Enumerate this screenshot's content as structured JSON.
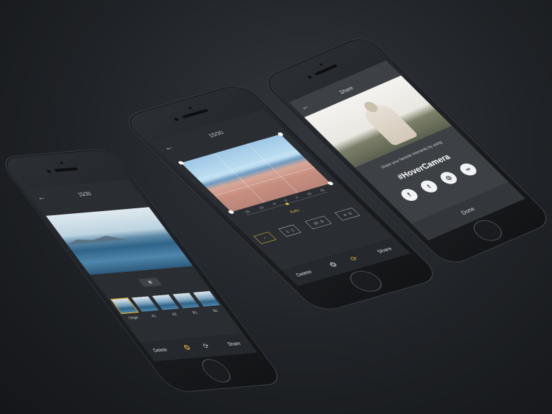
{
  "phones": {
    "edit": {
      "back_icon": "←",
      "counter": "15/30",
      "magic_icon": "✲",
      "filters": [
        {
          "name": "Origin",
          "selected": true
        },
        {
          "name": "A1",
          "selected": false
        },
        {
          "name": "A2",
          "selected": false
        },
        {
          "name": "B1",
          "selected": false
        },
        {
          "name": "B2",
          "selected": false
        }
      ],
      "bottom": {
        "delete": "Delete",
        "share": "Share"
      }
    },
    "crop": {
      "back_icon": "←",
      "counter": "15/30",
      "dial_ticks": [
        "-15",
        "-10",
        "-5",
        "0",
        "5",
        "10",
        "15"
      ],
      "auto_label": "Auto",
      "ratios": [
        {
          "label": "⌐",
          "selected": true
        },
        {
          "label": "1 : 1",
          "selected": false
        },
        {
          "label": "16 : 9",
          "selected": false
        },
        {
          "label": "4 : 3",
          "selected": false
        }
      ],
      "bottom": {
        "delete": "Delete",
        "share": "Share"
      }
    },
    "share": {
      "back_icon": "←",
      "title": "Share",
      "message": "Share your favorite moments by using",
      "hashtag": "#HoverCamera",
      "socials": [
        {
          "name": "facebook",
          "glyph": "f"
        },
        {
          "name": "twitter",
          "glyph": "t"
        },
        {
          "name": "instagram",
          "glyph": "◎"
        },
        {
          "name": "wechat",
          "glyph": "∞"
        }
      ],
      "done": "Done"
    }
  },
  "colors": {
    "accent": "#e3b93a",
    "background": "#1f2226",
    "screen": "#2a2d32"
  }
}
